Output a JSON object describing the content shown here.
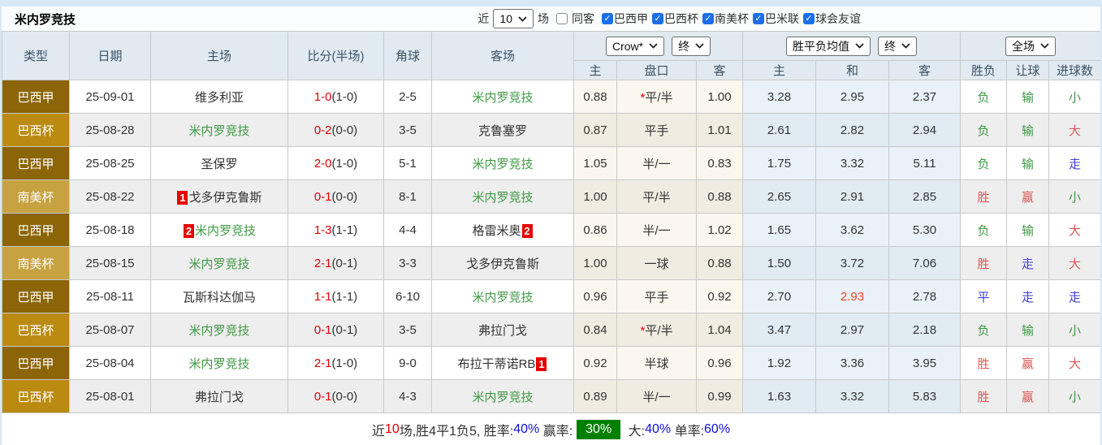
{
  "header_bar": {
    "title": "米内罗竞技",
    "recent_label": "近",
    "recent_value": "10",
    "matches_label": "场",
    "same_away_label": "同客",
    "same_away_checked": false,
    "filters": [
      {
        "label": "巴西甲",
        "checked": true
      },
      {
        "label": "巴西杯",
        "checked": true
      },
      {
        "label": "南美杯",
        "checked": true
      },
      {
        "label": "巴米联",
        "checked": true
      },
      {
        "label": "球会友谊",
        "checked": true
      }
    ]
  },
  "table": {
    "columns": [
      "类型",
      "日期",
      "主场",
      "比分(半场)",
      "角球",
      "客场"
    ],
    "dropdowns": {
      "company": "Crow*",
      "company_time": "终",
      "average": "胜平负均值",
      "average_time": "终",
      "scope": "全场"
    },
    "sub_columns": [
      "主",
      "盘口",
      "客",
      "主",
      "和",
      "客",
      "胜负",
      "让球",
      "进球数"
    ],
    "rows": [
      {
        "league": "巴西甲",
        "date": "25-09-01",
        "home": "维多利亚",
        "home_self": false,
        "home_red": null,
        "score": "1-0",
        "half": "(1-0)",
        "corners": "2-5",
        "away": "米内罗竞技",
        "away_self": true,
        "away_red": null,
        "star": true,
        "crow": [
          "0.88",
          "平/半",
          "1.00"
        ],
        "avg": [
          "3.28",
          "2.95",
          "2.37"
        ],
        "avg_red": -1,
        "results": [
          "负",
          "输",
          "小"
        ],
        "result_colors": [
          "green",
          "green",
          "green"
        ]
      },
      {
        "league": "巴西杯",
        "date": "25-08-28",
        "home": "米内罗竞技",
        "home_self": true,
        "home_red": null,
        "score": "0-2",
        "half": "(0-0)",
        "corners": "3-5",
        "away": "克鲁塞罗",
        "away_self": false,
        "away_red": null,
        "star": false,
        "crow": [
          "0.87",
          "平手",
          "1.01"
        ],
        "avg": [
          "2.61",
          "2.82",
          "2.94"
        ],
        "avg_red": -1,
        "results": [
          "负",
          "输",
          "大"
        ],
        "result_colors": [
          "green",
          "green",
          "red"
        ]
      },
      {
        "league": "巴西甲",
        "date": "25-08-25",
        "home": "圣保罗",
        "home_self": false,
        "home_red": null,
        "score": "2-0",
        "half": "(1-0)",
        "corners": "5-1",
        "away": "米内罗竞技",
        "away_self": true,
        "away_red": null,
        "star": false,
        "crow": [
          "1.05",
          "半/一",
          "0.83"
        ],
        "avg": [
          "1.75",
          "3.32",
          "5.11"
        ],
        "avg_red": -1,
        "results": [
          "负",
          "输",
          "走"
        ],
        "result_colors": [
          "green",
          "green",
          "blue"
        ]
      },
      {
        "league": "南美杯",
        "date": "25-08-22",
        "home": "戈多伊克鲁斯",
        "home_self": false,
        "home_red": "1",
        "score": "0-1",
        "half": "(0-0)",
        "corners": "8-1",
        "away": "米内罗竞技",
        "away_self": true,
        "away_red": null,
        "star": false,
        "crow": [
          "1.00",
          "平/半",
          "0.88"
        ],
        "avg": [
          "2.65",
          "2.91",
          "2.85"
        ],
        "avg_red": -1,
        "results": [
          "胜",
          "赢",
          "小"
        ],
        "result_colors": [
          "red",
          "red",
          "green"
        ]
      },
      {
        "league": "巴西甲",
        "date": "25-08-18",
        "home": "米内罗竞技",
        "home_self": true,
        "home_red": "2",
        "score": "1-3",
        "half": "(1-1)",
        "corners": "4-4",
        "away": "格雷米奥",
        "away_self": false,
        "away_red": "2",
        "star": false,
        "crow": [
          "0.86",
          "半/一",
          "1.02"
        ],
        "avg": [
          "1.65",
          "3.62",
          "5.30"
        ],
        "avg_red": -1,
        "results": [
          "负",
          "输",
          "大"
        ],
        "result_colors": [
          "green",
          "green",
          "red"
        ]
      },
      {
        "league": "南美杯",
        "date": "25-08-15",
        "home": "米内罗竞技",
        "home_self": true,
        "home_red": null,
        "score": "2-1",
        "half": "(0-1)",
        "corners": "3-3",
        "away": "戈多伊克鲁斯",
        "away_self": false,
        "away_red": null,
        "star": false,
        "crow": [
          "1.00",
          "一球",
          "0.88"
        ],
        "avg": [
          "1.50",
          "3.72",
          "7.06"
        ],
        "avg_red": -1,
        "results": [
          "胜",
          "走",
          "大"
        ],
        "result_colors": [
          "red",
          "blue",
          "red"
        ]
      },
      {
        "league": "巴西甲",
        "date": "25-08-11",
        "home": "瓦斯科达伽马",
        "home_self": false,
        "home_red": null,
        "score": "1-1",
        "half": "(1-1)",
        "corners": "6-10",
        "away": "米内罗竞技",
        "away_self": true,
        "away_red": null,
        "star": false,
        "crow": [
          "0.96",
          "平手",
          "0.92"
        ],
        "avg": [
          "2.70",
          "2.93",
          "2.78"
        ],
        "avg_red": 1,
        "results": [
          "平",
          "走",
          "走"
        ],
        "result_colors": [
          "blue",
          "blue",
          "blue"
        ]
      },
      {
        "league": "巴西杯",
        "date": "25-08-07",
        "home": "米内罗竞技",
        "home_self": true,
        "home_red": null,
        "score": "0-1",
        "half": "(0-1)",
        "corners": "3-5",
        "away": "弗拉门戈",
        "away_self": false,
        "away_red": null,
        "star": true,
        "crow": [
          "0.84",
          "平/半",
          "1.04"
        ],
        "avg": [
          "3.47",
          "2.97",
          "2.18"
        ],
        "avg_red": -1,
        "results": [
          "负",
          "输",
          "小"
        ],
        "result_colors": [
          "green",
          "green",
          "green"
        ]
      },
      {
        "league": "巴西甲",
        "date": "25-08-04",
        "home": "米内罗竞技",
        "home_self": true,
        "home_red": null,
        "score": "2-1",
        "half": "(1-0)",
        "corners": "9-0",
        "away": "布拉干蒂诺RB",
        "away_self": false,
        "away_red": "1",
        "star": false,
        "crow": [
          "0.92",
          "半球",
          "0.96"
        ],
        "avg": [
          "1.92",
          "3.36",
          "3.95"
        ],
        "avg_red": -1,
        "results": [
          "胜",
          "赢",
          "大"
        ],
        "result_colors": [
          "red",
          "red",
          "red"
        ]
      },
      {
        "league": "巴西杯",
        "date": "25-08-01",
        "home": "弗拉门戈",
        "home_self": false,
        "home_red": null,
        "score": "0-1",
        "half": "(0-0)",
        "corners": "4-3",
        "away": "米内罗竞技",
        "away_self": true,
        "away_red": null,
        "star": false,
        "crow": [
          "0.89",
          "半/一",
          "0.99"
        ],
        "avg": [
          "1.63",
          "3.32",
          "5.83"
        ],
        "avg_red": -1,
        "results": [
          "胜",
          "赢",
          "小"
        ],
        "result_colors": [
          "red",
          "red",
          "green"
        ]
      }
    ]
  },
  "summary": {
    "segments": [
      {
        "text": "近",
        "style": "plain"
      },
      {
        "text": "10",
        "style": "red"
      },
      {
        "text": "场,胜4平1负5, 胜率:",
        "style": "plain"
      },
      {
        "text": "40%",
        "style": "blue"
      },
      {
        "text": " 赢率:",
        "style": "plain"
      },
      {
        "text": "30%",
        "style": "badge"
      },
      {
        "text": " 大:",
        "style": "plain"
      },
      {
        "text": "40%",
        "style": "blue"
      },
      {
        "text": " 单率:",
        "style": "plain"
      },
      {
        "text": "60%",
        "style": "blue"
      }
    ]
  },
  "colors": {
    "accent_red": "#e60000",
    "team_green": "#3f9a44",
    "result_red": "#e05656",
    "result_green": "#3f9a44",
    "result_blue": "#4040d8",
    "avg_highlight_red": "#ee4422",
    "summary_blue": "#1010dd",
    "win_rate_badge_bg": "#008000",
    "header_bg": "#e1eaf1",
    "top_strip": "#d8e8f5",
    "league_colors": {
      "巴西甲": "#8b6508",
      "巴西杯": "#ba8b10",
      "南美杯": "#c7a240"
    }
  }
}
